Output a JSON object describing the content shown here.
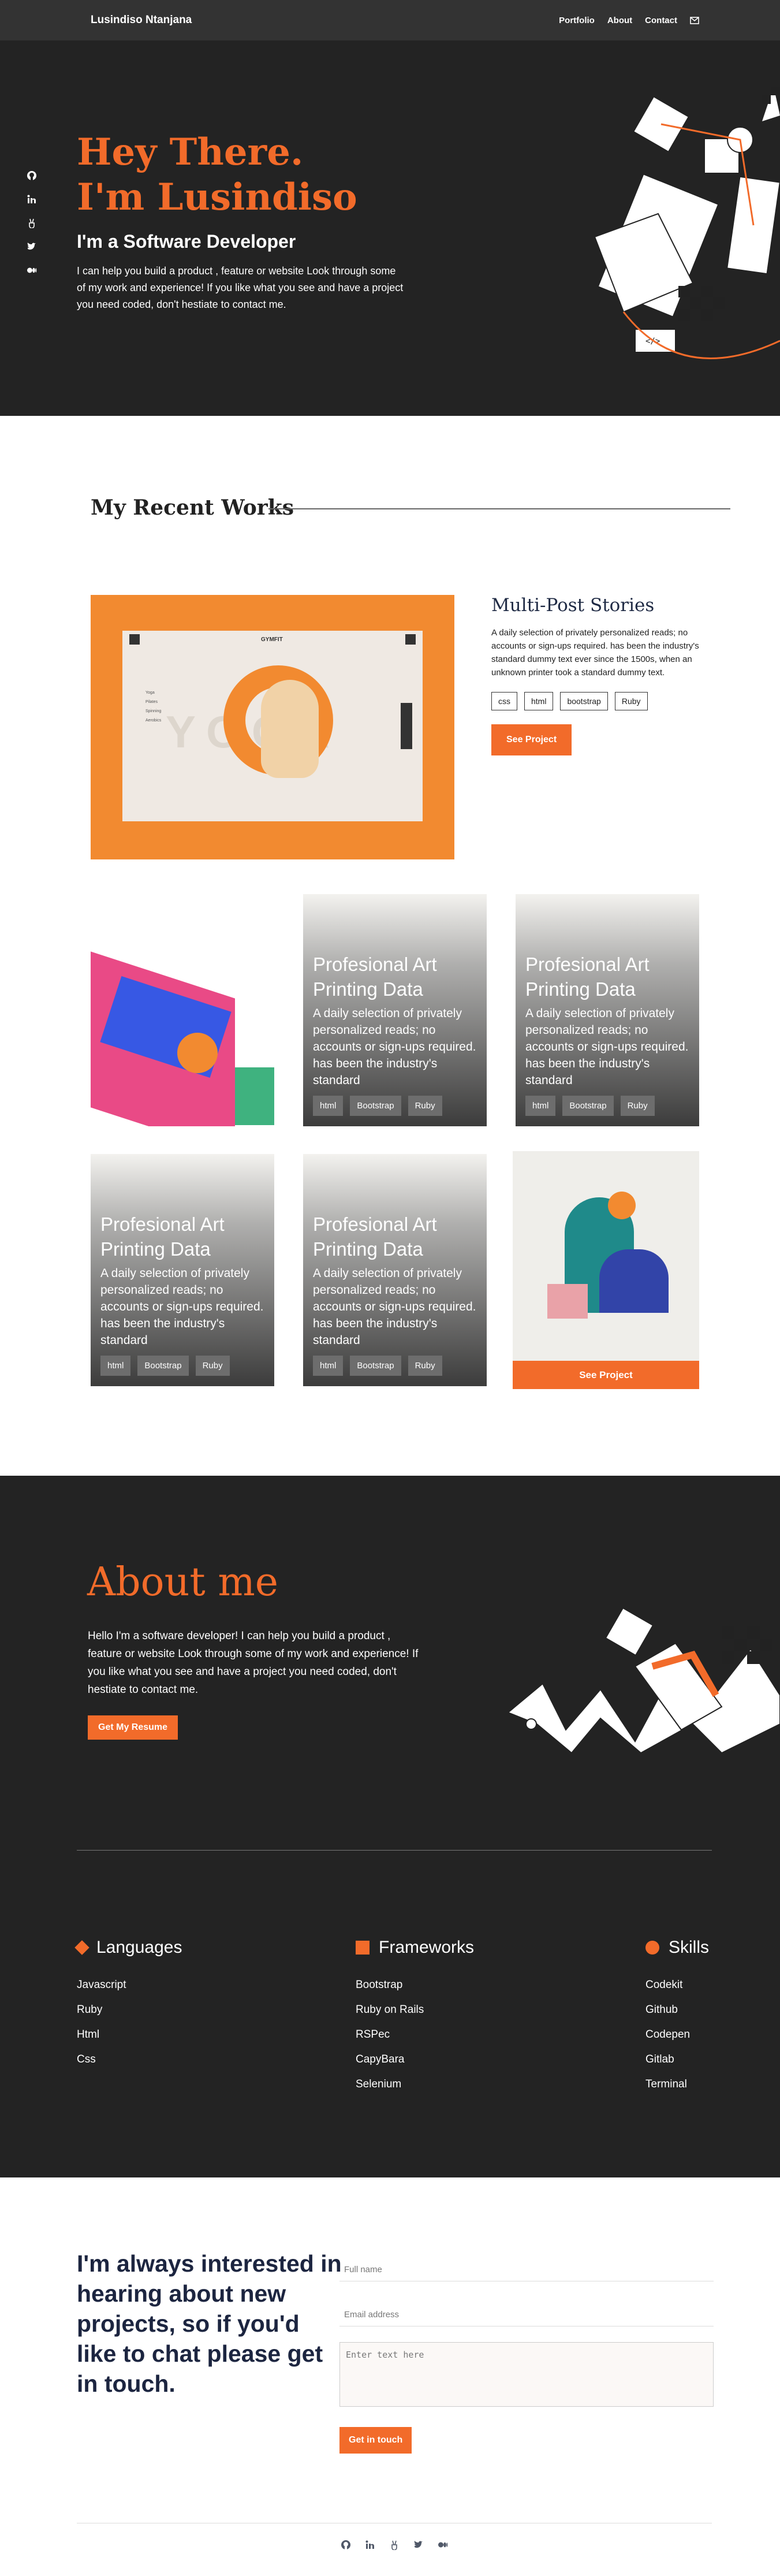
{
  "nav": {
    "brand": "Lusindiso Ntanjana",
    "links": [
      "Portfolio",
      "About",
      "Contact"
    ],
    "mail_icon": "envelope-icon"
  },
  "hero": {
    "title_line1": "Hey There.",
    "title_line2": "I'm Lusindiso",
    "subtitle": "I'm a Software Developer",
    "text": "I can help you build a product , feature or website Look through some of my work and experience! If you like what you see and have a project you need coded, don't hestiate to contact me.",
    "social_icons": [
      "github-icon",
      "linkedin-icon",
      "angellist-icon",
      "twitter-icon",
      "medium-icon"
    ]
  },
  "works": {
    "title": "My Recent Works",
    "feature": {
      "title": "Multi-Post Stories",
      "text": "A daily selection of privately personalized reads; no accounts or sign-ups required. has been the industry's standard dummy text ever since the 1500s, when an unknown printer took a standard dummy text.",
      "tags": [
        "css",
        "html",
        "bootstrap",
        "Ruby"
      ],
      "button": "See Project",
      "mock_logo": "GYMFIT",
      "mock_word": "YOGA",
      "mock_menu": [
        "Yoga",
        "Pilates",
        "Spinning",
        "Aerobics"
      ]
    },
    "card_title": "Profesional Art Printing Data",
    "card_text": "A daily selection of privately personalized reads; no accounts or sign-ups required. has been the industry's standard",
    "card_tags": [
      "html",
      "Bootstrap",
      "Ruby"
    ],
    "card_button": "See Project"
  },
  "about": {
    "title": "About me",
    "text": "Hello I'm a software developer! I can help you build a product , feature or website Look through some of my work and experience! If you like what you see and have a project you need coded, don't hestiate to contact me.",
    "button": "Get My Resume"
  },
  "skills": {
    "languages": {
      "title": "Languages",
      "items": [
        "Javascript",
        "Ruby",
        "Html",
        "Css"
      ]
    },
    "frameworks": {
      "title": "Frameworks",
      "items": [
        "Bootstrap",
        "Ruby on Rails",
        "RSPec",
        "CapyBara",
        "Selenium"
      ]
    },
    "skills": {
      "title": "Skills",
      "items": [
        "Codekit",
        "Github",
        "Codepen",
        "Gitlab",
        "Terminal"
      ]
    }
  },
  "contact": {
    "lead": "I'm always interested in hearing about new projects, so if you'd like to chat please get in touch.",
    "name_placeholder": "Full name",
    "email_placeholder": "Email address",
    "message_placeholder": "Enter text here",
    "button": "Get in touch"
  },
  "colors": {
    "accent": "#f26b2a",
    "dark": "#232323",
    "navy": "#1c2540"
  }
}
